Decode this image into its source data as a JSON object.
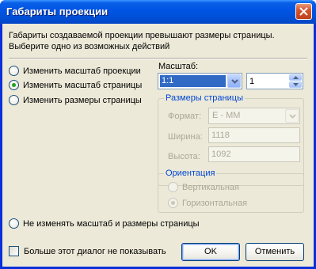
{
  "window": {
    "title": "Габариты проекции"
  },
  "description": {
    "line1": "Габариты создаваемой проекции превышают размеры страницы.",
    "line2": "Выберите одно из возможных действий"
  },
  "options": {
    "change_projection_scale": "Изменить масштаб проекции",
    "change_page_scale": "Изменить масштаб страницы",
    "change_page_size": "Изменить размеры страницы",
    "keep_all": "Не изменять масштаб и размеры страницы",
    "selected": "change_page_scale"
  },
  "scale": {
    "label": "Масштаб:",
    "ratio_value": "1:1",
    "factor_value": "1"
  },
  "page_size": {
    "group_title": "Размеры страницы",
    "format_label": "Формат:",
    "format_value": "E - MM",
    "width_label": "Ширина:",
    "width_value": "1118",
    "height_label": "Высота:",
    "height_value": "1092"
  },
  "orientation": {
    "group_title": "Ориентация",
    "portrait": "Вертикальная",
    "landscape": "Горизонтальная",
    "selected": "landscape"
  },
  "footer": {
    "dont_show_label": "Больше этот диалог не показывать",
    "dont_show_checked": false,
    "ok_label": "OK",
    "cancel_label": "Отменить"
  },
  "colors": {
    "titlebar": "#0054e3",
    "dialog_bg": "#ece9d8",
    "selection": "#316ac5",
    "group_title": "#0046d5",
    "radio_dot": "#21a121"
  }
}
